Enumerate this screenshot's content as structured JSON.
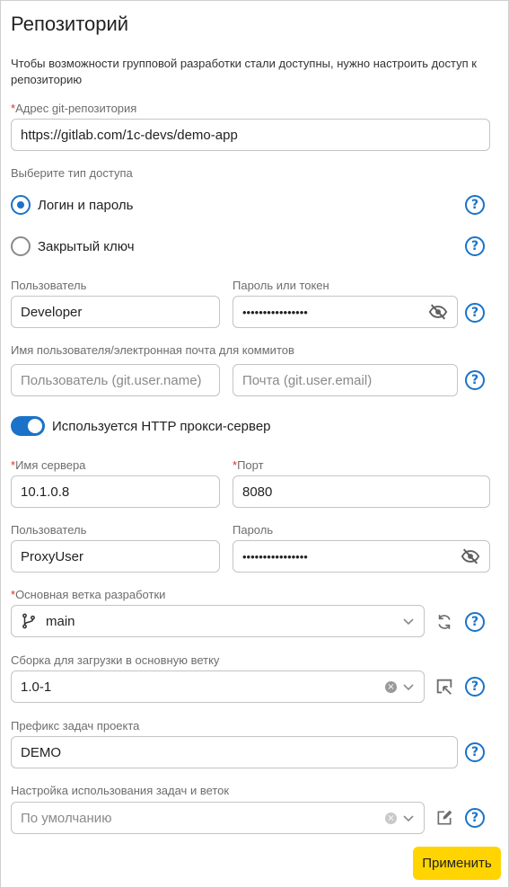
{
  "page": {
    "title": "Репозиторий",
    "description": "Чтобы возможности групповой разработки стали доступны, нужно настроить доступ к репозиторию"
  },
  "repo": {
    "label": "Адрес git-репозитория",
    "value": "https://gitlab.com/1c-devs/demo-app"
  },
  "access": {
    "label": "Выберите тип доступа",
    "options": [
      {
        "label": "Логин и пароль",
        "selected": true
      },
      {
        "label": "Закрытый ключ",
        "selected": false
      }
    ]
  },
  "credentials": {
    "user_label": "Пользователь",
    "user_value": "Developer",
    "password_label": "Пароль или токен",
    "password_value": "••••••••••••••••"
  },
  "commit": {
    "label": "Имя пользователя/электронная почта для коммитов",
    "name_placeholder": "Пользователь (git.user.name)",
    "email_placeholder": "Почта (git.user.email)"
  },
  "proxy": {
    "toggle_label": "Используется HTTP прокси-сервер",
    "enabled": true,
    "server_label": "Имя сервера",
    "server_value": "10.1.0.8",
    "port_label": "Порт",
    "port_value": "8080",
    "user_label": "Пользователь",
    "user_value": "ProxyUser",
    "password_label": "Пароль",
    "password_value": "••••••••••••••••"
  },
  "branch": {
    "label": "Основная ветка разработки",
    "value": "main"
  },
  "build": {
    "label": "Сборка для загрузки в основную ветку",
    "value": "1.0-1"
  },
  "prefix": {
    "label": "Префикс задач проекта",
    "value": "DEMO"
  },
  "tasks": {
    "label": "Настройка использования задач и веток",
    "placeholder": "По умолчанию"
  },
  "required_mark": "*",
  "help_glyph": "?",
  "clear_glyph": "×",
  "apply_label": "Применить",
  "colors": {
    "accent": "#1a73c8",
    "required": "#e0302b",
    "apply": "#ffd400"
  }
}
